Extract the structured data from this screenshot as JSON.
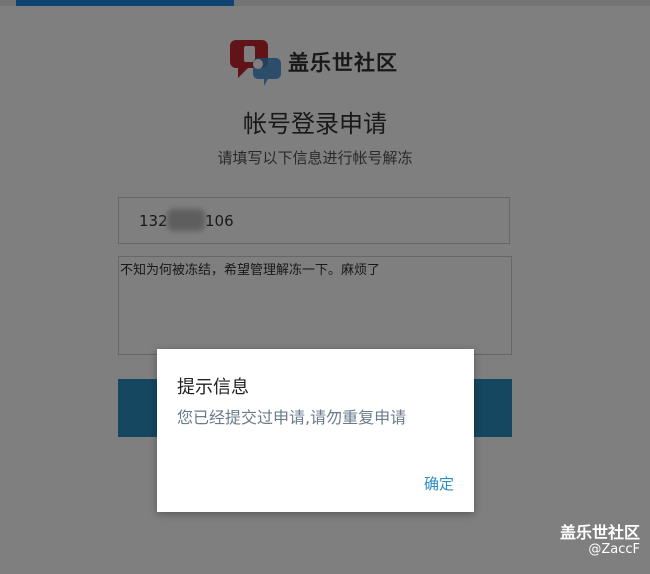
{
  "site": {
    "name": "盖乐世社区"
  },
  "form": {
    "title": "帐号登录申请",
    "subtitle": "请填写以下信息进行帐号解冻",
    "phone_prefix": "132",
    "phone_suffix": "106",
    "reason": "不知为何被冻结，希望管理解冻一下。麻烦了"
  },
  "dialog": {
    "title": "提示信息",
    "message": "您已经提交过申请,请勿重复申请",
    "ok_label": "确定"
  },
  "watermark": {
    "site": "盖乐世社区",
    "user": "@ZaccF"
  },
  "colors": {
    "accent": "#2d8ec1",
    "logo_red": "#c0282e",
    "logo_blue": "#3b8bd0",
    "progress": "#1e88e5"
  },
  "icons": {
    "logo": "chat-bubbles-logo-icon"
  }
}
